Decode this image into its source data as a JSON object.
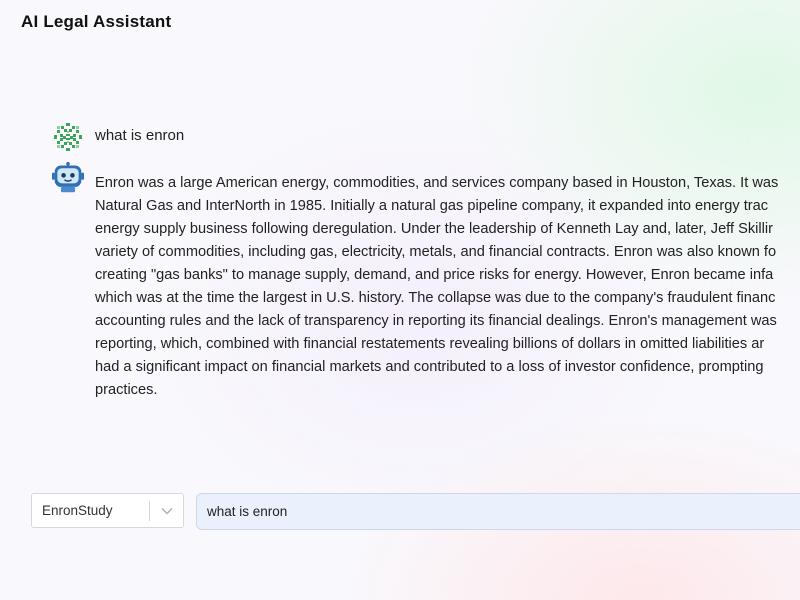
{
  "app": {
    "title": "AI Legal Assistant"
  },
  "conversation": {
    "user_message": {
      "text": "what is enron",
      "avatar_icon": "green-pattern-avatar-icon"
    },
    "assistant_message": {
      "avatar_icon": "robot-avatar-icon",
      "lines": [
        "Enron was a large American energy, commodities, and services company based in Houston, Texas. It was",
        "Natural Gas and InterNorth in 1985. Initially a natural gas pipeline company, it expanded into energy trac",
        "energy supply business following deregulation. Under the leadership of Kenneth Lay and, later, Jeff Skillir",
        "variety of commodities, including gas, electricity, metals, and financial contracts. Enron was also known fo",
        "creating \"gas banks\" to manage supply, demand, and price risks for energy. However, Enron became infa",
        "which was at the time the largest in U.S. history. The collapse was due to the company's fraudulent financ",
        "accounting rules and the lack of transparency in reporting its financial dealings. Enron's management was",
        "reporting, which, combined with financial restatements revealing billions of dollars in omitted liabilities ar",
        "had a significant impact on financial markets and contributed to a loss of investor confidence, prompting",
        "practices."
      ]
    }
  },
  "input_bar": {
    "dataset_select": {
      "value": "EnronStudy",
      "arrow_icon": "chevron-down-icon"
    },
    "query_input": {
      "value": "what is enron"
    }
  },
  "colors": {
    "input_background": "#eaf0fc",
    "avatar_green": "#3aa657",
    "robot_blue": "#2f6fb3"
  }
}
